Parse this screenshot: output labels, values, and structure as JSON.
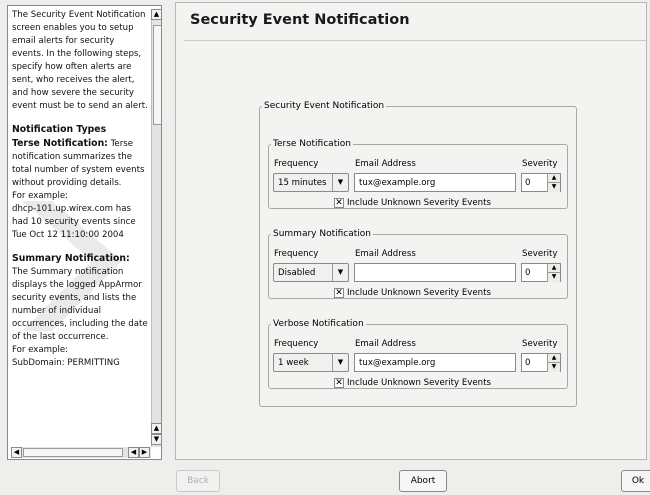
{
  "help": {
    "intro": "The Security Event Notification screen enables you to setup email alerts for security events. In the following steps, specify how often alerts are sent, who receives the alert, and how severe the security event must be to send an alert.",
    "types_heading": "Notification Types",
    "terse_label": "Terse Notification:",
    "terse_text": "Terse notification summarizes the total number of system events without providing details.",
    "terse_example_label": "For example:",
    "terse_example": "dhcp-101.up.wirex.com has had 10 security events since Tue Oct 12 11:10:00 2004",
    "summary_label": "Summary Notification:",
    "summary_text": "The Summary notification displays the logged AppArmor security events, and lists the number of individual occurrences, including the date of the last occurrence.",
    "summary_example_label": "For example:",
    "summary_example_cut": "SubDomain: PERMITTING"
  },
  "page": {
    "title": "Security Event Notification"
  },
  "group": {
    "title": "Security Event Notification"
  },
  "labels": {
    "frequency": "Frequency",
    "email": "Email Address",
    "severity": "Severity",
    "include_unknown": "Include Unknown Severity Events"
  },
  "notifications": {
    "terse": {
      "title": "Terse Notification",
      "frequency": "15 minutes",
      "email": "tux@example.org",
      "severity": "0",
      "include_unknown": true
    },
    "summary": {
      "title": "Summary Notification",
      "frequency": "Disabled",
      "email": "",
      "severity": "0",
      "include_unknown": true
    },
    "verbose": {
      "title": "Verbose Notification",
      "frequency": "1 week",
      "email": "tux@example.org",
      "severity": "0",
      "include_unknown": true
    }
  },
  "buttons": {
    "back": "Back",
    "abort": "Abort",
    "ok": "Ok"
  },
  "icons": {
    "dropdown": "chevron-down-icon",
    "spin_up": "arrow-up-icon",
    "spin_down": "arrow-down-icon",
    "checkbox": "x-check-icon"
  }
}
